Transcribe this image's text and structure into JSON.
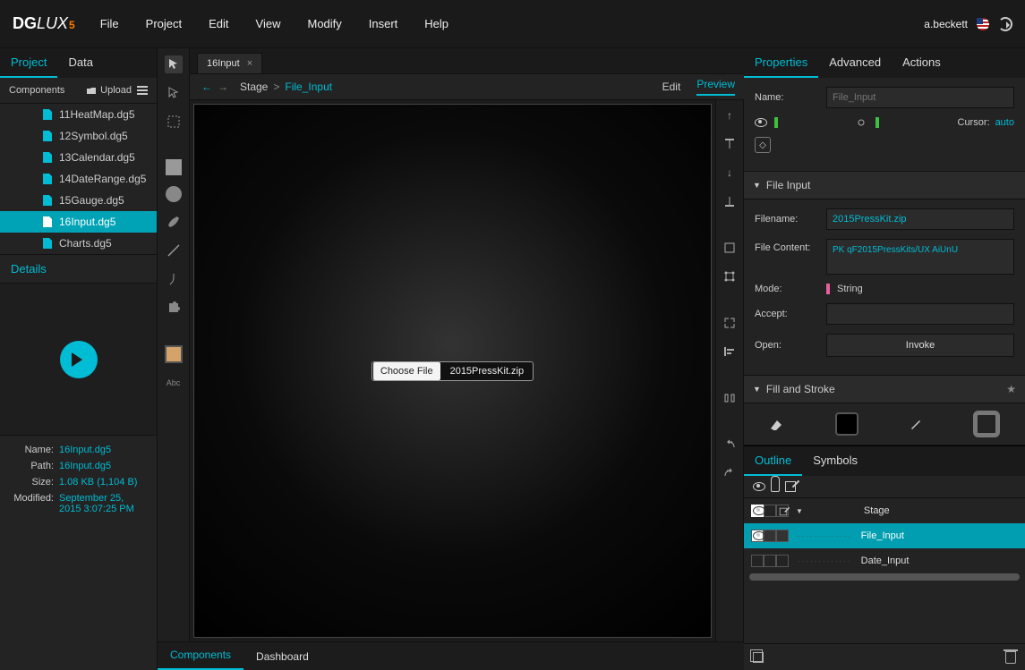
{
  "menu": {
    "file": "File",
    "project": "Project",
    "edit": "Edit",
    "view": "View",
    "modify": "Modify",
    "insert": "Insert",
    "help": "Help"
  },
  "user": {
    "name": "a.beckett"
  },
  "left_tabs": {
    "project": "Project",
    "data": "Data"
  },
  "components": {
    "label": "Components",
    "upload": "Upload"
  },
  "files": [
    {
      "name": "11HeatMap.dg5"
    },
    {
      "name": "12Symbol.dg5"
    },
    {
      "name": "13Calendar.dg5"
    },
    {
      "name": "14DateRange.dg5"
    },
    {
      "name": "15Gauge.dg5"
    },
    {
      "name": "16Input.dg5",
      "selected": true
    },
    {
      "name": "Charts.dg5"
    }
  ],
  "details": {
    "header": "Details"
  },
  "meta": {
    "name_k": "Name:",
    "name_v": "16Input.dg5",
    "path_k": "Path:",
    "path_v": "16Input.dg5",
    "size_k": "Size:",
    "size_v": "1.08 KB (1,104 B)",
    "mod_k": "Modified:",
    "mod_v": "September 25, 2015 3:07:25 PM"
  },
  "toolstrip_text": "Abc",
  "doc_tab": {
    "name": "16Input"
  },
  "crumbs": {
    "stage": "Stage",
    "sep": ">",
    "file_input": "File_Input",
    "edit": "Edit",
    "preview": "Preview"
  },
  "file_widget": {
    "button": "Choose File",
    "filename": "2015PressKit.zip"
  },
  "ptabs": {
    "properties": "Properties",
    "advanced": "Advanced",
    "actions": "Actions"
  },
  "props": {
    "name_label": "Name:",
    "name_placeholder": "File_Input",
    "cursor_label": "Cursor:",
    "cursor_value": "auto",
    "section_file_input": "File Input",
    "filename_label": "Filename:",
    "filename_value": "2015PressKit.zip",
    "filecontent_label": "File Content:",
    "filecontent_value": "PK\n\u0003q\u0003F2015PressKits/UX Ai\u0003U\u0003n\u0003U",
    "mode_label": "Mode:",
    "mode_value": "String",
    "accept_label": "Accept:",
    "accept_value": "",
    "open_label": "Open:",
    "open_value": "Invoke",
    "section_fill_stroke": "Fill and Stroke"
  },
  "outline_tabs": {
    "outline": "Outline",
    "symbols": "Symbols"
  },
  "outline": {
    "stage": "Stage",
    "file_input": "File_Input",
    "date_input": "Date_Input"
  },
  "bottom": {
    "components": "Components",
    "dashboard": "Dashboard"
  }
}
